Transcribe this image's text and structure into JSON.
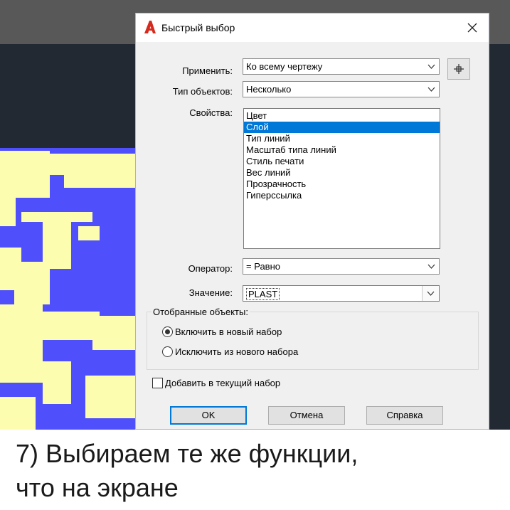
{
  "dialog": {
    "title": "Быстрый выбор",
    "apply_label": "Применить:",
    "apply_value": "Ко всему чертежу",
    "object_type_label": "Тип объектов:",
    "object_type_value": "Несколько",
    "properties_label": "Свойства:",
    "properties": [
      {
        "label": "Цвет",
        "selected": false
      },
      {
        "label": "Слой",
        "selected": true
      },
      {
        "label": "Тип линий",
        "selected": false
      },
      {
        "label": "Масштаб типа линий",
        "selected": false
      },
      {
        "label": "Стиль печати",
        "selected": false
      },
      {
        "label": "Вес линий",
        "selected": false
      },
      {
        "label": "Прозрачность",
        "selected": false
      },
      {
        "label": "Гиперссылка",
        "selected": false
      }
    ],
    "operator_label": "Оператор:",
    "operator_value": "= Равно",
    "value_label": "Значение:",
    "value_value": "PLAST",
    "how_to_apply_label": "Отобранные объекты:",
    "include_label": "Включить в новый набор",
    "exclude_label": "Исключить из нового набора",
    "include_selected": true,
    "append_label": "Добавить в текущий набор",
    "append_checked": false,
    "ok_label": "OK",
    "cancel_label": "Отмена",
    "help_label": "Справка"
  },
  "caption": {
    "line1": "7) Выбираем те же функции,",
    "line2": "что на экране"
  },
  "colors": {
    "accent": "#0078d7",
    "canvas_blue": "#4f4ffc",
    "canvas_yellow": "#fdfdb0",
    "app_icon_red": "#d52b1e"
  }
}
